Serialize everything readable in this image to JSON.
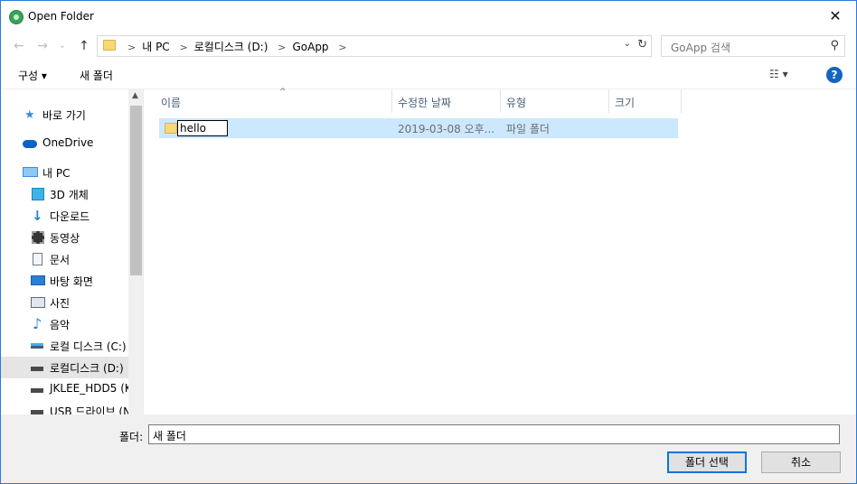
{
  "window": {
    "title": "Open Folder",
    "close_glyph": "✕"
  },
  "nav": {
    "back_glyph": "←",
    "forward_glyph": "→",
    "recent_glyph": "⌄",
    "up_glyph": "↑",
    "breadcrumbs": [
      "내 PC",
      "로컬디스크 (D:)",
      "GoApp"
    ],
    "dropdown_glyph": "⌄",
    "refresh_glyph": "↻",
    "search_placeholder": "GoApp 검색",
    "search_glyph": "⚲"
  },
  "toolbar": {
    "organize": "구성 ▾",
    "new_folder": "새 폴더",
    "view": "☷ ▾",
    "help": "?"
  },
  "sidebar": {
    "items": [
      {
        "label": "바로 가기",
        "icon": "star-icon",
        "color": "#3b8de0"
      },
      {
        "label": "OneDrive",
        "icon": "cloud-icon",
        "color": "#0a64c8"
      },
      {
        "label": "내 PC",
        "icon": "computer-icon",
        "color": "#3b8de0"
      },
      {
        "label": "3D 개체",
        "icon": "cube-icon",
        "color": "#3fb3e8"
      },
      {
        "label": "다운로드",
        "icon": "download-icon",
        "color": "#2a7fd4"
      },
      {
        "label": "동영상",
        "icon": "film-icon",
        "color": "#333333"
      },
      {
        "label": "문서",
        "icon": "document-icon",
        "color": "#6a7a8c"
      },
      {
        "label": "바탕 화면",
        "icon": "desktop-icon",
        "color": "#2a7fd4"
      },
      {
        "label": "사진",
        "icon": "picture-icon",
        "color": "#5b6b80"
      },
      {
        "label": "음악",
        "icon": "music-icon",
        "color": "#2a7fd4"
      },
      {
        "label": "로컬 디스크 (C:)",
        "icon": "windows-drive-icon",
        "color": "#4a5a70"
      },
      {
        "label": "로컬디스크 (D:)",
        "icon": "drive-icon",
        "color": "#4a4a4a",
        "selected": true
      },
      {
        "label": "JKLEE_HDD5 (K:",
        "icon": "drive-icon",
        "color": "#4a4a4a"
      },
      {
        "label": "USB 드라이브 (N",
        "icon": "usb-drive-icon",
        "color": "#4a4a4a"
      }
    ],
    "scroll_up_glyph": "▲"
  },
  "columns": [
    "이름",
    "수정한 날짜",
    "유형",
    "크기"
  ],
  "sort_glyph": "^",
  "rows": [
    {
      "name": "hello",
      "modified": "2019-03-08 오후...",
      "type": "파일 폴더",
      "size": ""
    }
  ],
  "footer": {
    "folder_label": "폴더:",
    "folder_value": "새 폴더",
    "select_button": "폴더 선택",
    "cancel_button": "취소"
  }
}
